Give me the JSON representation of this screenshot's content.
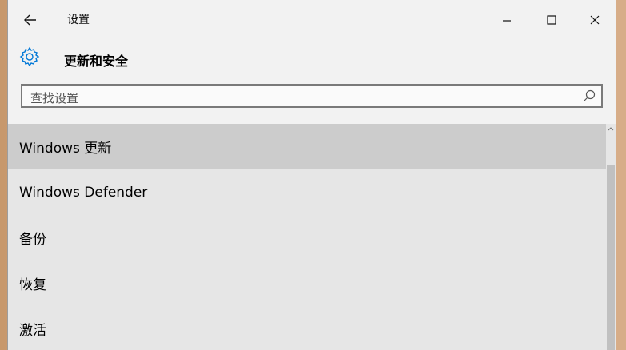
{
  "window": {
    "title": "设置"
  },
  "header": {
    "title": "更新和安全",
    "icon": "gear-icon"
  },
  "search": {
    "placeholder": "查找设置"
  },
  "list": {
    "items": [
      {
        "label": "Windows 更新",
        "selected": true
      },
      {
        "label": "Windows Defender",
        "selected": false
      },
      {
        "label": "备份",
        "selected": false
      },
      {
        "label": "恢复",
        "selected": false
      },
      {
        "label": "激活",
        "selected": false
      }
    ]
  },
  "colors": {
    "accent": "#0078d7",
    "selected_bg": "#cccccc",
    "list_bg": "#e6e6e6"
  }
}
